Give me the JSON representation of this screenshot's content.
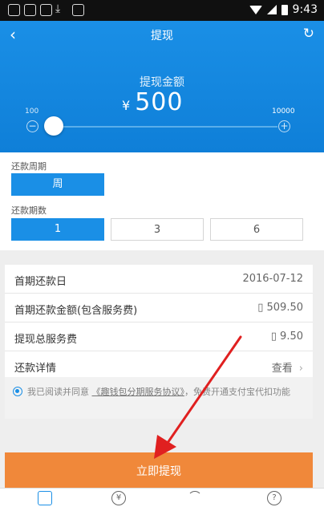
{
  "status_bar": {
    "time": "9:43"
  },
  "header": {
    "back_icon": "‹",
    "title": "提现",
    "refresh_icon": "↻"
  },
  "amount": {
    "label": "提现金额",
    "currency": "¥",
    "value": "500",
    "slider_min": "100",
    "slider_max": "10000",
    "slider_position": 0.0
  },
  "repayment": {
    "cycle_label": "还款周期",
    "cycle_options": [
      "周"
    ],
    "periods_label": "还款期数",
    "periods_options": [
      "1",
      "3",
      "6"
    ],
    "periods_selected": "1"
  },
  "details": [
    {
      "label": "首期还款日",
      "value": "2016-07-12"
    },
    {
      "label": "首期还款金额(包含服务费)",
      "value": "▯ 509.50"
    },
    {
      "label": "提现总服务费",
      "value": "▯ 9.50"
    },
    {
      "label": "还款详情",
      "value": "查看"
    }
  ],
  "agreement": {
    "prefix": "我已阅读并同意",
    "link": "《趣钱包分期服务协议》",
    "suffix": "，免费开通支付宝代扣功能"
  },
  "primary_button": "立即提现",
  "colors": {
    "primary_blue": "#1a8fe6",
    "accent_orange": "#f0883a",
    "annotation_red": "#e02020"
  }
}
